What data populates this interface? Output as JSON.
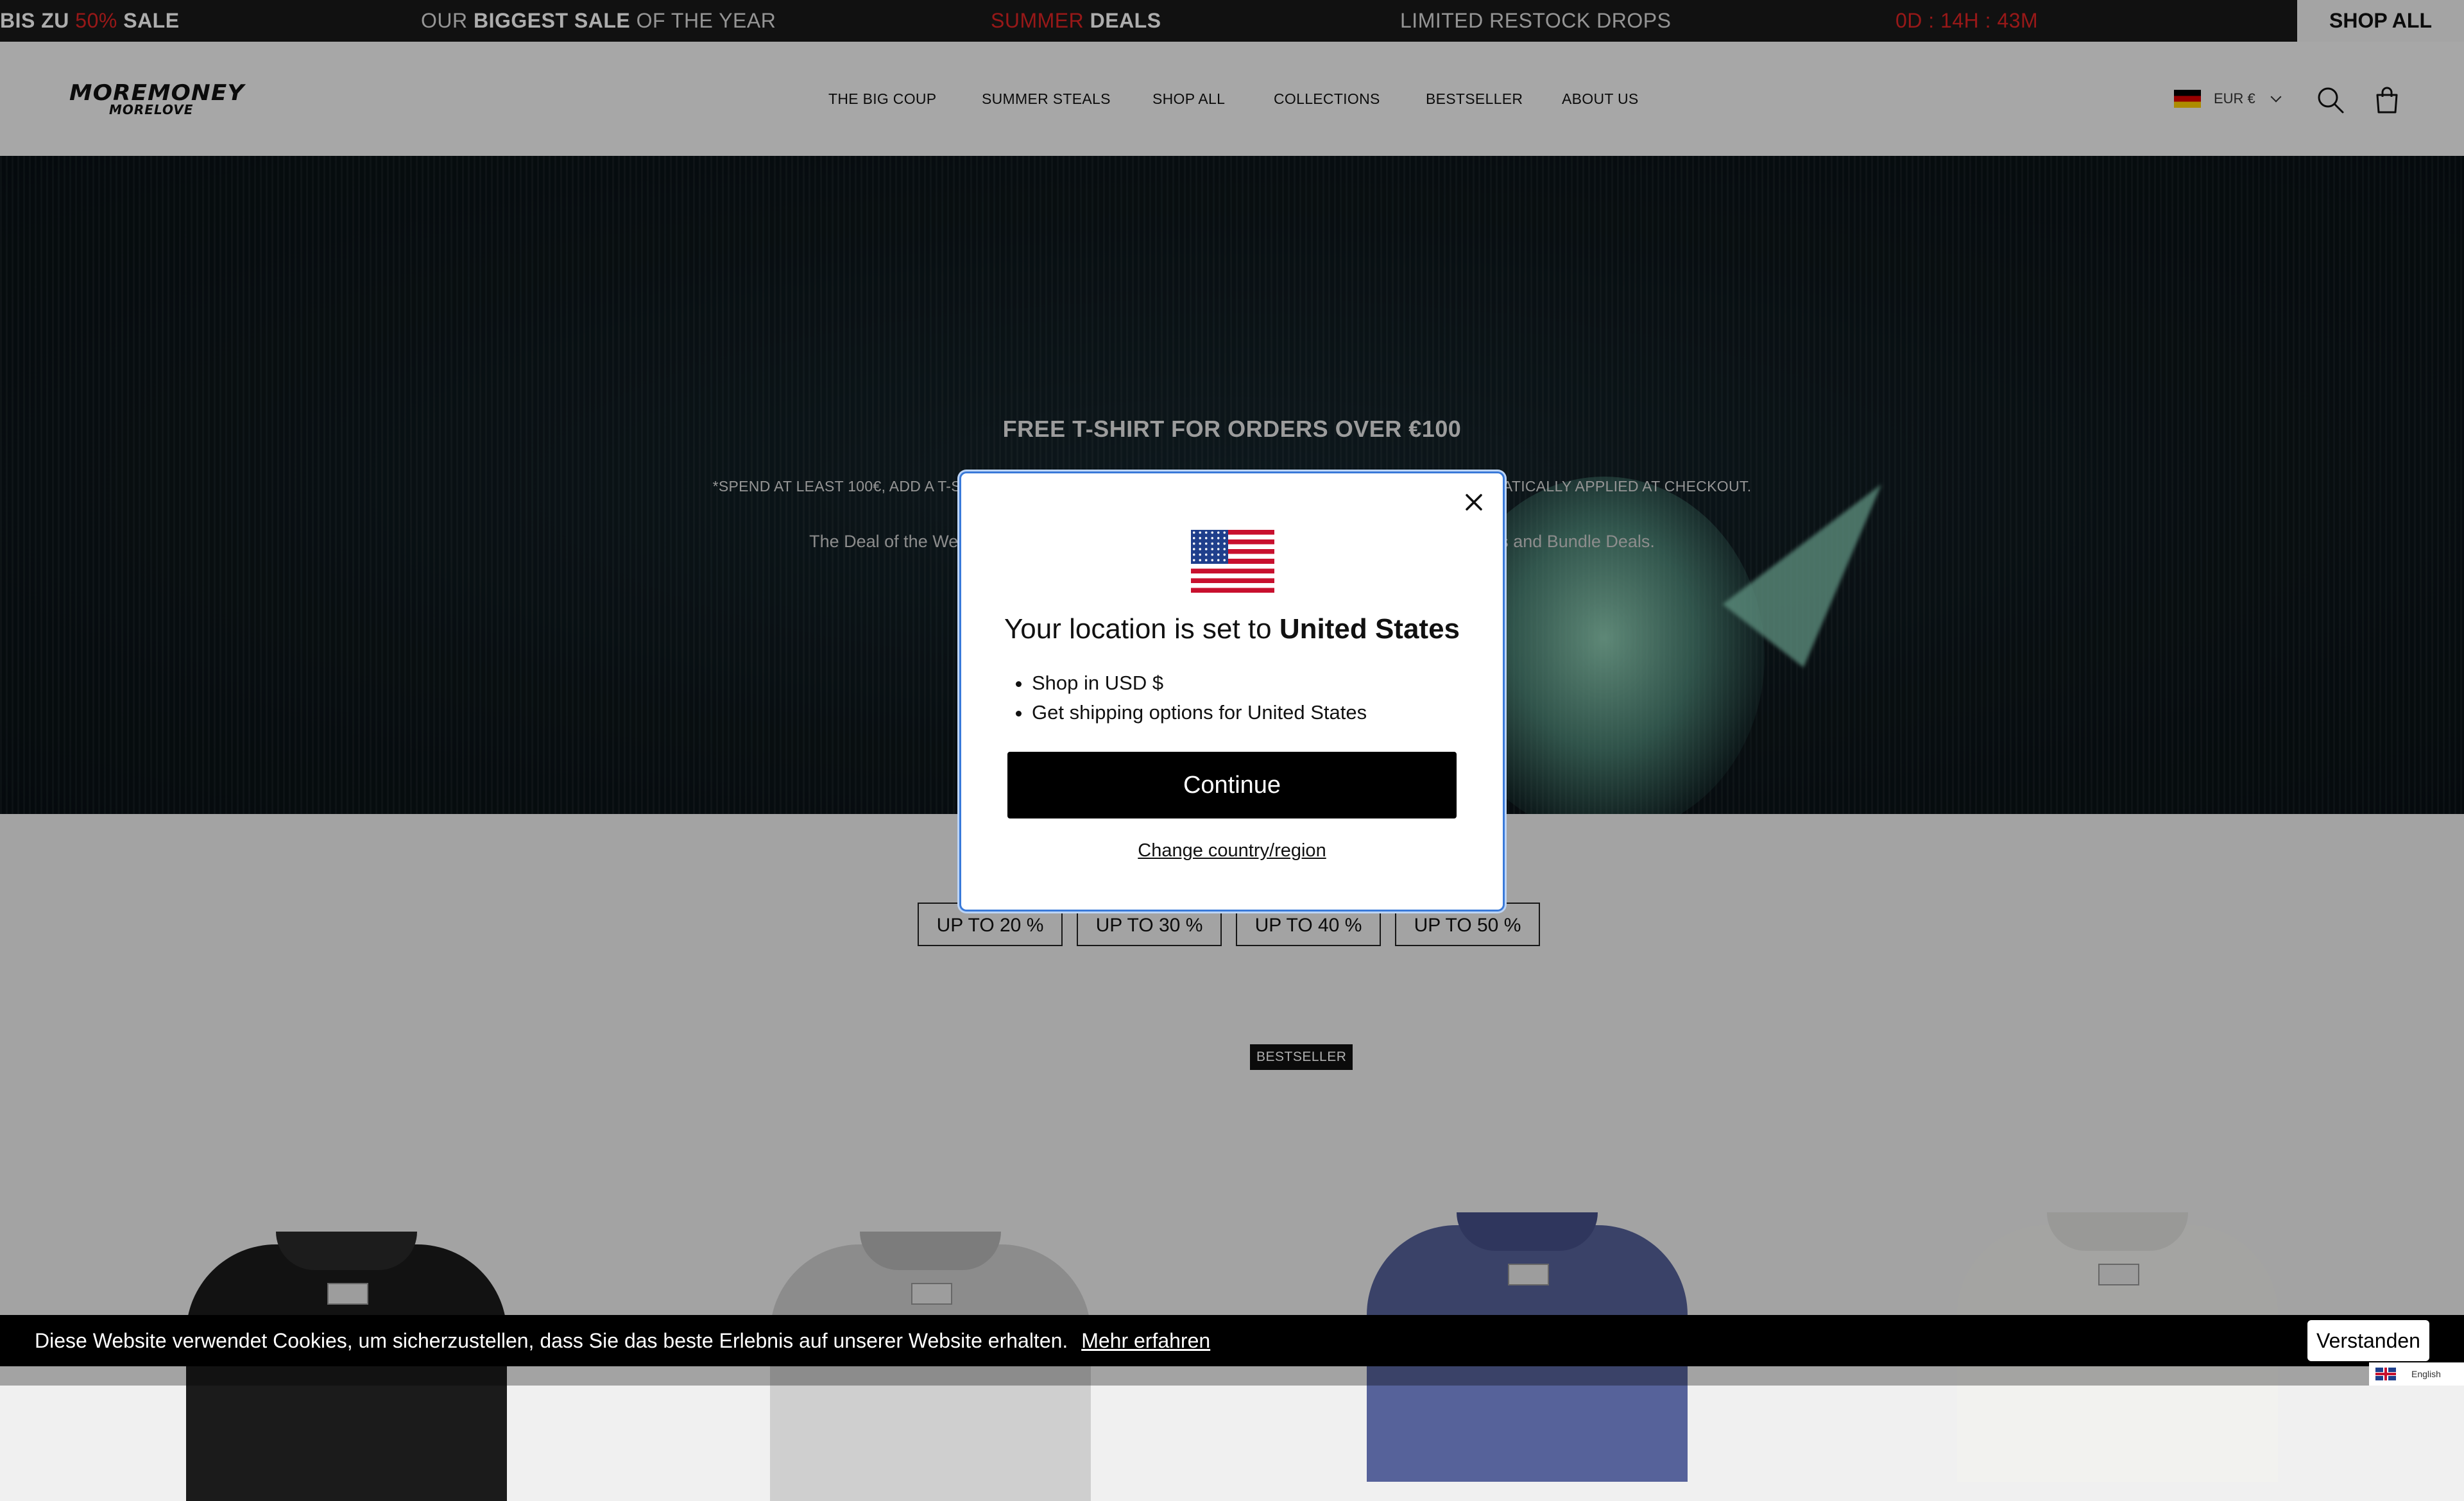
{
  "announcement": {
    "items": [
      {
        "pre": "BIS ZU",
        "accent": "50%",
        "post": "SALE"
      },
      {
        "pre": "OUR",
        "bold": "BIGGEST SALE",
        "post": "OF THE YEAR"
      },
      {
        "accent": "SUMMER",
        "bold": "DEALS"
      },
      {
        "text": "LIMITED RESTOCK DROPS"
      },
      {
        "countdown": "0D : 14H : 43M"
      }
    ],
    "shop_all": "SHOP ALL"
  },
  "header": {
    "logo_line1": "MOREMONEY",
    "logo_line2": "MORELOVE",
    "nav": [
      "THE BIG COUP",
      "SUMMER STEALS",
      "SHOP ALL",
      "COLLECTIONS",
      "BESTSELLER",
      "ABOUT US"
    ],
    "currency": "EUR €",
    "icons": {
      "search": "search-icon",
      "cart": "bag-icon",
      "flag": "germany-flag-icon"
    }
  },
  "hero": {
    "title": "FREE T-SHIRT FOR ORDERS OVER €100",
    "sub_left": "*SPEND AT LEAST 100€, ADD A T-S",
    "sub_right": "ATICALLY APPLIED AT CHECKOUT.",
    "deal_left": "The Deal of the We",
    "deal_right": "s and Bundle Deals."
  },
  "discounts": [
    "UP TO 20 %",
    "UP TO 30 %",
    "UP TO 40 %",
    "UP TO 50 %"
  ],
  "badge": "BESTSELLER",
  "products": [
    {
      "color": "#1b1b1b",
      "collar": "#2a2a2a"
    },
    {
      "color": "#cfcfcf",
      "collar": "#b7b7b7"
    },
    {
      "color": "#56629a",
      "collar": "#46508a"
    },
    {
      "color": "#f2f2ef",
      "collar": "#e2e2df"
    }
  ],
  "modal": {
    "title_pre": "Your location is set to",
    "title_country": "United States",
    "bullets": [
      "Shop in USD $",
      "Get shipping options for United States"
    ],
    "continue": "Continue",
    "change": "Change country/region",
    "icons": {
      "flag": "us-flag-icon",
      "close": "close-icon"
    }
  },
  "cookie": {
    "message": "Diese Website verwendet Cookies, um sicherzustellen, dass Sie das beste Erlebnis auf unserer Website erhalten.",
    "more": "Mehr erfahren",
    "accept": "Verstanden"
  },
  "language": "English",
  "colors": {
    "accent_red": "#e02424",
    "modal_focus": "#3a7ad9",
    "announcement_bg": "#1a1a1a"
  }
}
